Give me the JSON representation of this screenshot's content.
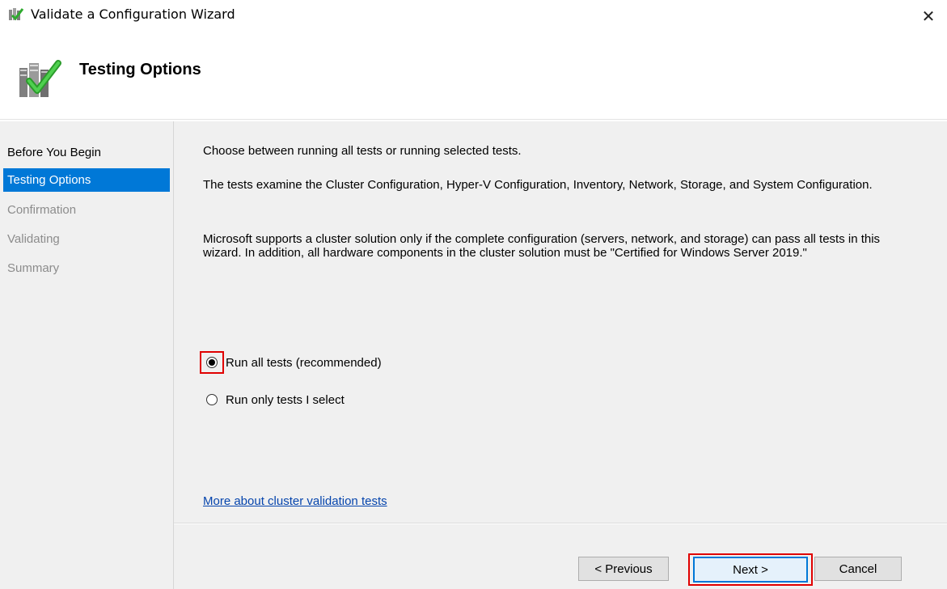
{
  "window": {
    "title": "Validate a Configuration Wizard",
    "close_symbol": "✕",
    "icon": "cluster-validate-icon"
  },
  "header": {
    "title": "Testing Options",
    "icon": "testing-options-check-icon"
  },
  "sidebar": {
    "items": [
      {
        "label": "Before You Begin",
        "state": "normal"
      },
      {
        "label": "Testing Options",
        "state": "active"
      },
      {
        "label": "Confirmation",
        "state": "disabled"
      },
      {
        "label": "Validating",
        "state": "disabled"
      },
      {
        "label": "Summary",
        "state": "disabled"
      }
    ]
  },
  "main": {
    "intro": "Choose between running all tests or running selected tests.",
    "tests_description": "The tests examine the Cluster Configuration, Hyper-V Configuration, Inventory, Network, Storage, and System Configuration.",
    "support_note": "Microsoft supports a cluster solution only if the complete configuration (servers, network, and storage) can pass all tests in this wizard. In addition, all hardware components in the cluster solution must be \"Certified for Windows Server 2019.\"",
    "options": [
      {
        "label": "Run all tests (recommended)",
        "selected": true
      },
      {
        "label": "Run only tests I select",
        "selected": false
      }
    ],
    "link": "More about cluster validation tests"
  },
  "buttons": {
    "previous": "< Previous",
    "next": "Next >",
    "cancel": "Cancel"
  },
  "colors": {
    "accent": "#0078d7",
    "highlight": "#e00000",
    "link": "#0645ad"
  }
}
